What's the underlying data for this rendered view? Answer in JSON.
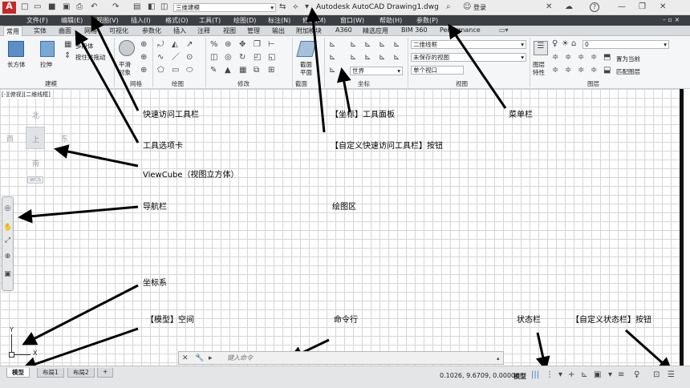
{
  "titlebar": {
    "workspace": "三维建模",
    "title": "Autodesk AutoCAD  Drawing1.dwg",
    "login": "登录",
    "qa_icons": [
      "new-icon",
      "open-icon",
      "save-icon",
      "saveas-icon",
      "print-icon",
      "undo-icon",
      "redo-icon",
      "plot-icon",
      "publish-icon",
      "share-icon"
    ]
  },
  "menu": [
    "文件(F)",
    "编辑(E)",
    "视图(V)",
    "插入(I)",
    "格式(O)",
    "工具(T)",
    "绘图(D)",
    "标注(N)",
    "修改(M)",
    "窗口(W)",
    "帮助(H)",
    "参数(P)"
  ],
  "tabs": [
    "常用",
    "实体",
    "曲面",
    "网格",
    "可视化",
    "参数化",
    "插入",
    "注释",
    "视图",
    "管理",
    "输出",
    "附加模块",
    "A360",
    "精选应用",
    "BIM 360",
    "Performance"
  ],
  "ribbon": {
    "modeling": {
      "box": "长方体",
      "extrude": "拉伸",
      "polysolid": "多段体",
      "presspull": "按住并拖动",
      "title": "建模"
    },
    "mesh": {
      "smooth": "平滑",
      "smooth2": "对象",
      "title": "网格"
    },
    "draw": {
      "title": "绘图"
    },
    "modify": {
      "title": "修改"
    },
    "section": {
      "plane1": "截面",
      "plane2": "平面",
      "title": "截面"
    },
    "coords": {
      "world": "世界",
      "title": "坐标"
    },
    "view": {
      "style": "二维线框",
      "saved": "未保存的视图",
      "viewport": "单个视口",
      "title": "视图"
    },
    "layers": {
      "props1": "图层",
      "props2": "特性",
      "layer": "0",
      "setcurrent": "置为当前",
      "match": "匹配图层",
      "title": "图层"
    }
  },
  "drawing": {
    "viewport_label": "[-][俯视][二维线框]",
    "compass": {
      "n": "北",
      "w": "西",
      "e": "东",
      "s": "南",
      "top": "上",
      "wcs": "WCS"
    },
    "ucs_y": "Y",
    "ucs_x": "X"
  },
  "annotations": [
    "快速访问工具栏",
    "工具选项卡",
    "ViewCube（视图立方体）",
    "导航栏",
    "坐标系",
    "【模型】空间",
    "【坐标】工具面板",
    "【自定义快速访问工具栏】按钮",
    "绘图区",
    "命令行",
    "菜单栏",
    "状态栏",
    "【自定义状态栏】按钮"
  ],
  "cmdline": {
    "placeholder": "键入命令"
  },
  "layouts": [
    "模型",
    "布局1",
    "布局2"
  ],
  "status": {
    "coords": "0.1026, 9.6709, 0.0000",
    "mode": "模型"
  },
  "colors": {
    "accent": "#c0392b",
    "menubar": "#3c3f44",
    "grid": "#d6d6d6"
  }
}
